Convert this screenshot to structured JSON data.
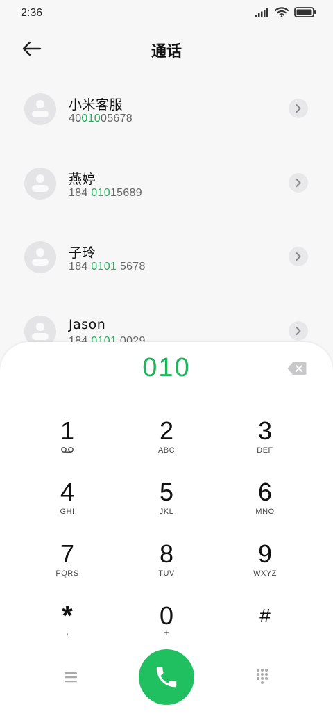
{
  "status_bar": {
    "time": "2:36",
    "icons": [
      "signal-icon",
      "wifi-icon",
      "battery-icon"
    ]
  },
  "header": {
    "title": "通话",
    "back_icon": "arrow-left-icon"
  },
  "contacts": [
    {
      "name": "小米客服",
      "number_parts": [
        "40",
        "010",
        "05678"
      ]
    },
    {
      "name": "燕婷",
      "number_parts": [
        "184 ",
        "010",
        "15689"
      ]
    },
    {
      "name": "子玲",
      "number_parts": [
        "184 ",
        "0101",
        " 5678"
      ]
    },
    {
      "name": "Jason",
      "number_parts": [
        "184 ",
        "0101",
        " 0029"
      ]
    }
  ],
  "dialpad": {
    "display": "010",
    "keys": [
      {
        "digit": "1",
        "letters": ""
      },
      {
        "digit": "2",
        "letters": "ABC"
      },
      {
        "digit": "3",
        "letters": "DEF"
      },
      {
        "digit": "4",
        "letters": "GHI"
      },
      {
        "digit": "5",
        "letters": "JKL"
      },
      {
        "digit": "6",
        "letters": "MNO"
      },
      {
        "digit": "7",
        "letters": "PQRS"
      },
      {
        "digit": "8",
        "letters": "TUV"
      },
      {
        "digit": "9",
        "letters": "WXYZ"
      },
      {
        "digit": "*",
        "letters": ","
      },
      {
        "digit": "0",
        "letters": "+"
      },
      {
        "digit": "#",
        "letters": ""
      }
    ]
  },
  "colors": {
    "accent": "#1fb35c",
    "call_button": "#20bf5f",
    "avatar_bg": "#e4e4e6"
  }
}
